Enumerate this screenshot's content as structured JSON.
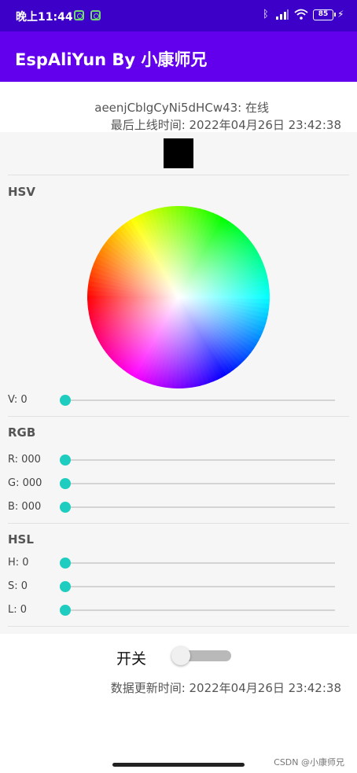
{
  "status_bar": {
    "time": "晚上11:44",
    "battery": "85",
    "icons": [
      "notification-icon",
      "notification-icon",
      "bluetooth-icon",
      "signal-icon",
      "wifi-icon",
      "battery-icon",
      "charging-icon"
    ]
  },
  "app_bar": {
    "title": "EspAliYun By 小康师兄",
    "color": "#6200ee"
  },
  "device": {
    "status": "aeenjCblgCyNi5dHCw43: 在线",
    "last_online": "最后上线时间: 2022年04月26日 23:42:38"
  },
  "color_preview": "#000000",
  "hsv": {
    "title": "HSV",
    "v_label": "V: 0",
    "v": 0
  },
  "rgb": {
    "title": "RGB",
    "r_label": "R: 000",
    "g_label": "G: 000",
    "b_label": "B: 000",
    "r": 0,
    "g": 0,
    "b": 0
  },
  "hsl": {
    "title": "HSL",
    "h_label": "H: 0",
    "s_label": "S: 0",
    "l_label": "L: 0",
    "h": 0,
    "s": 0,
    "l": 0
  },
  "switch": {
    "label": "开关",
    "on": false
  },
  "data_update": "数据更新时间: 2022年04月26日 23:42:38",
  "accent_color": "#1ecdc0",
  "watermark": "CSDN @小康师兄"
}
